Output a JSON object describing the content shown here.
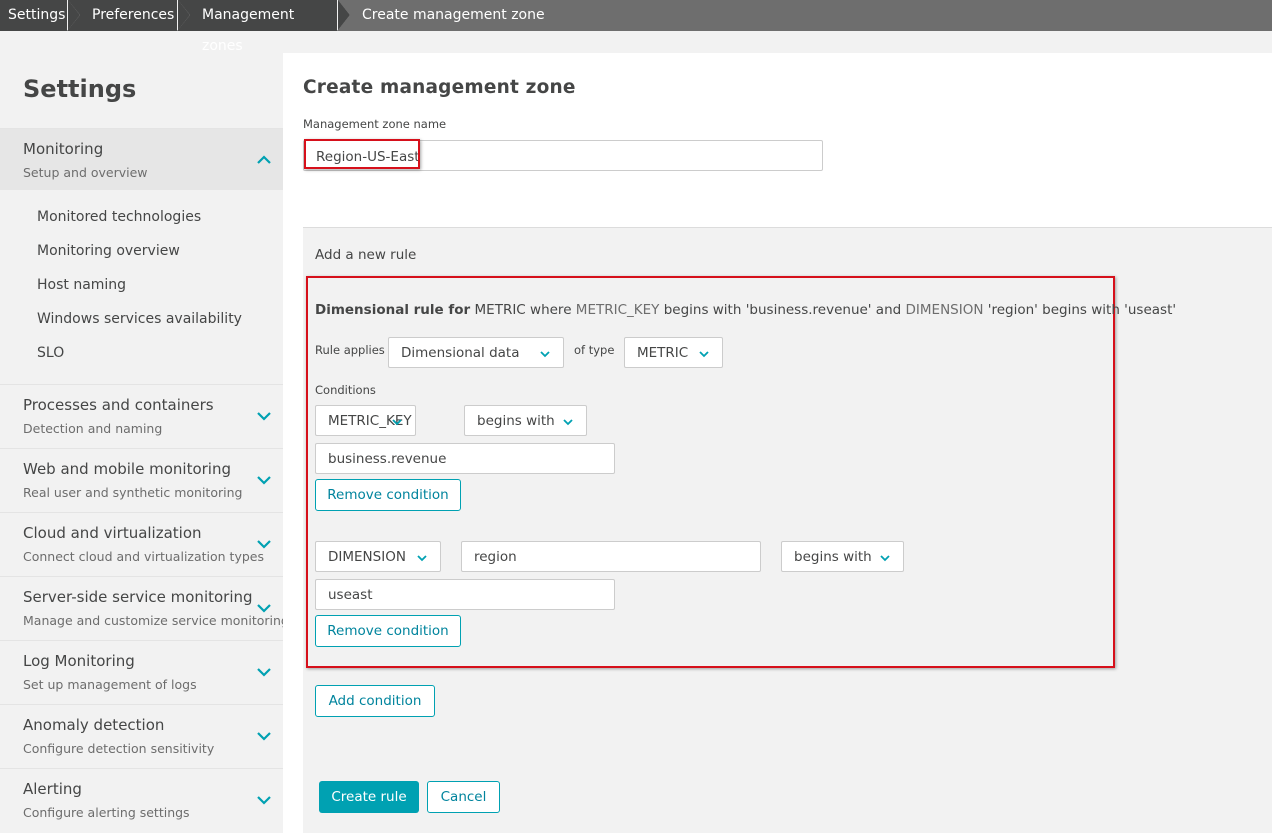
{
  "breadcrumb": [
    "Settings",
    "Preferences",
    "Management zones",
    "Create management zone"
  ],
  "sidebar": {
    "title": "Settings",
    "monitoring": {
      "label": "Monitoring",
      "sub": "Setup and overview",
      "items": [
        "Monitored technologies",
        "Monitoring overview",
        "Host naming",
        "Windows services availability",
        "SLO"
      ]
    },
    "sections": [
      {
        "label": "Processes and containers",
        "sub": "Detection and naming"
      },
      {
        "label": "Web and mobile monitoring",
        "sub": "Real user and synthetic monitoring"
      },
      {
        "label": "Cloud and virtualization",
        "sub": "Connect cloud and virtualization types"
      },
      {
        "label": "Server-side service monitoring",
        "sub": "Manage and customize service monitoring"
      },
      {
        "label": "Log Monitoring",
        "sub": "Set up management of logs"
      },
      {
        "label": "Anomaly detection",
        "sub": "Configure detection sensitivity"
      },
      {
        "label": "Alerting",
        "sub": "Configure alerting settings"
      }
    ]
  },
  "main": {
    "title": "Create management zone",
    "name_label": "Management zone name",
    "name_value": "Region-US-East",
    "add_rule_label": "Add a new rule",
    "rule_desc": {
      "bold": "Dimensional rule for",
      "t1": "METRIC",
      "t2": "where",
      "t3": "METRIC_KEY",
      "t4": "begins with 'business.revenue' and",
      "t5": "DIMENSION",
      "t6": "'region' begins with 'useast'"
    },
    "applies_label": "Rule applies to",
    "applies_value": "Dimensional data",
    "of_type_label": "of type",
    "type_value": "METRIC",
    "conditions_label": "Conditions",
    "condition1": {
      "key": "METRIC_KEY",
      "operator": "begins with",
      "value": "business.revenue",
      "remove": "Remove condition"
    },
    "condition2": {
      "key": "DIMENSION",
      "dimension": "region",
      "operator": "begins with",
      "value": "useast",
      "remove": "Remove condition"
    },
    "add_condition": "Add condition",
    "create_rule": "Create rule",
    "cancel": "Cancel"
  },
  "colors": {
    "accent": "#00a1b2",
    "highlight": "#d6101b",
    "breadcrumb_dark": "#454646"
  }
}
